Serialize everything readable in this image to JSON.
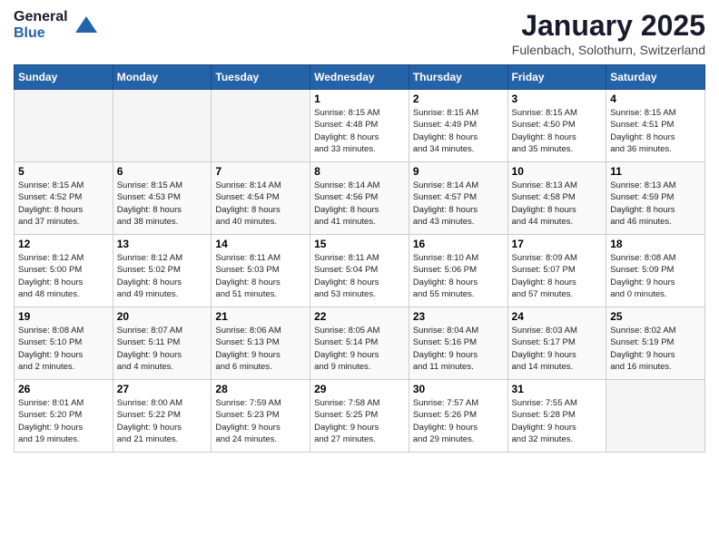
{
  "logo": {
    "general": "General",
    "blue": "Blue"
  },
  "title": {
    "month_year": "January 2025",
    "location": "Fulenbach, Solothurn, Switzerland"
  },
  "weekdays": [
    "Sunday",
    "Monday",
    "Tuesday",
    "Wednesday",
    "Thursday",
    "Friday",
    "Saturday"
  ],
  "weeks": [
    [
      {
        "day": "",
        "info": ""
      },
      {
        "day": "",
        "info": ""
      },
      {
        "day": "",
        "info": ""
      },
      {
        "day": "1",
        "info": "Sunrise: 8:15 AM\nSunset: 4:48 PM\nDaylight: 8 hours\nand 33 minutes."
      },
      {
        "day": "2",
        "info": "Sunrise: 8:15 AM\nSunset: 4:49 PM\nDaylight: 8 hours\nand 34 minutes."
      },
      {
        "day": "3",
        "info": "Sunrise: 8:15 AM\nSunset: 4:50 PM\nDaylight: 8 hours\nand 35 minutes."
      },
      {
        "day": "4",
        "info": "Sunrise: 8:15 AM\nSunset: 4:51 PM\nDaylight: 8 hours\nand 36 minutes."
      }
    ],
    [
      {
        "day": "5",
        "info": "Sunrise: 8:15 AM\nSunset: 4:52 PM\nDaylight: 8 hours\nand 37 minutes."
      },
      {
        "day": "6",
        "info": "Sunrise: 8:15 AM\nSunset: 4:53 PM\nDaylight: 8 hours\nand 38 minutes."
      },
      {
        "day": "7",
        "info": "Sunrise: 8:14 AM\nSunset: 4:54 PM\nDaylight: 8 hours\nand 40 minutes."
      },
      {
        "day": "8",
        "info": "Sunrise: 8:14 AM\nSunset: 4:56 PM\nDaylight: 8 hours\nand 41 minutes."
      },
      {
        "day": "9",
        "info": "Sunrise: 8:14 AM\nSunset: 4:57 PM\nDaylight: 8 hours\nand 43 minutes."
      },
      {
        "day": "10",
        "info": "Sunrise: 8:13 AM\nSunset: 4:58 PM\nDaylight: 8 hours\nand 44 minutes."
      },
      {
        "day": "11",
        "info": "Sunrise: 8:13 AM\nSunset: 4:59 PM\nDaylight: 8 hours\nand 46 minutes."
      }
    ],
    [
      {
        "day": "12",
        "info": "Sunrise: 8:12 AM\nSunset: 5:00 PM\nDaylight: 8 hours\nand 48 minutes."
      },
      {
        "day": "13",
        "info": "Sunrise: 8:12 AM\nSunset: 5:02 PM\nDaylight: 8 hours\nand 49 minutes."
      },
      {
        "day": "14",
        "info": "Sunrise: 8:11 AM\nSunset: 5:03 PM\nDaylight: 8 hours\nand 51 minutes."
      },
      {
        "day": "15",
        "info": "Sunrise: 8:11 AM\nSunset: 5:04 PM\nDaylight: 8 hours\nand 53 minutes."
      },
      {
        "day": "16",
        "info": "Sunrise: 8:10 AM\nSunset: 5:06 PM\nDaylight: 8 hours\nand 55 minutes."
      },
      {
        "day": "17",
        "info": "Sunrise: 8:09 AM\nSunset: 5:07 PM\nDaylight: 8 hours\nand 57 minutes."
      },
      {
        "day": "18",
        "info": "Sunrise: 8:08 AM\nSunset: 5:09 PM\nDaylight: 9 hours\nand 0 minutes."
      }
    ],
    [
      {
        "day": "19",
        "info": "Sunrise: 8:08 AM\nSunset: 5:10 PM\nDaylight: 9 hours\nand 2 minutes."
      },
      {
        "day": "20",
        "info": "Sunrise: 8:07 AM\nSunset: 5:11 PM\nDaylight: 9 hours\nand 4 minutes."
      },
      {
        "day": "21",
        "info": "Sunrise: 8:06 AM\nSunset: 5:13 PM\nDaylight: 9 hours\nand 6 minutes."
      },
      {
        "day": "22",
        "info": "Sunrise: 8:05 AM\nSunset: 5:14 PM\nDaylight: 9 hours\nand 9 minutes."
      },
      {
        "day": "23",
        "info": "Sunrise: 8:04 AM\nSunset: 5:16 PM\nDaylight: 9 hours\nand 11 minutes."
      },
      {
        "day": "24",
        "info": "Sunrise: 8:03 AM\nSunset: 5:17 PM\nDaylight: 9 hours\nand 14 minutes."
      },
      {
        "day": "25",
        "info": "Sunrise: 8:02 AM\nSunset: 5:19 PM\nDaylight: 9 hours\nand 16 minutes."
      }
    ],
    [
      {
        "day": "26",
        "info": "Sunrise: 8:01 AM\nSunset: 5:20 PM\nDaylight: 9 hours\nand 19 minutes."
      },
      {
        "day": "27",
        "info": "Sunrise: 8:00 AM\nSunset: 5:22 PM\nDaylight: 9 hours\nand 21 minutes."
      },
      {
        "day": "28",
        "info": "Sunrise: 7:59 AM\nSunset: 5:23 PM\nDaylight: 9 hours\nand 24 minutes."
      },
      {
        "day": "29",
        "info": "Sunrise: 7:58 AM\nSunset: 5:25 PM\nDaylight: 9 hours\nand 27 minutes."
      },
      {
        "day": "30",
        "info": "Sunrise: 7:57 AM\nSunset: 5:26 PM\nDaylight: 9 hours\nand 29 minutes."
      },
      {
        "day": "31",
        "info": "Sunrise: 7:55 AM\nSunset: 5:28 PM\nDaylight: 9 hours\nand 32 minutes."
      },
      {
        "day": "",
        "info": ""
      }
    ]
  ]
}
